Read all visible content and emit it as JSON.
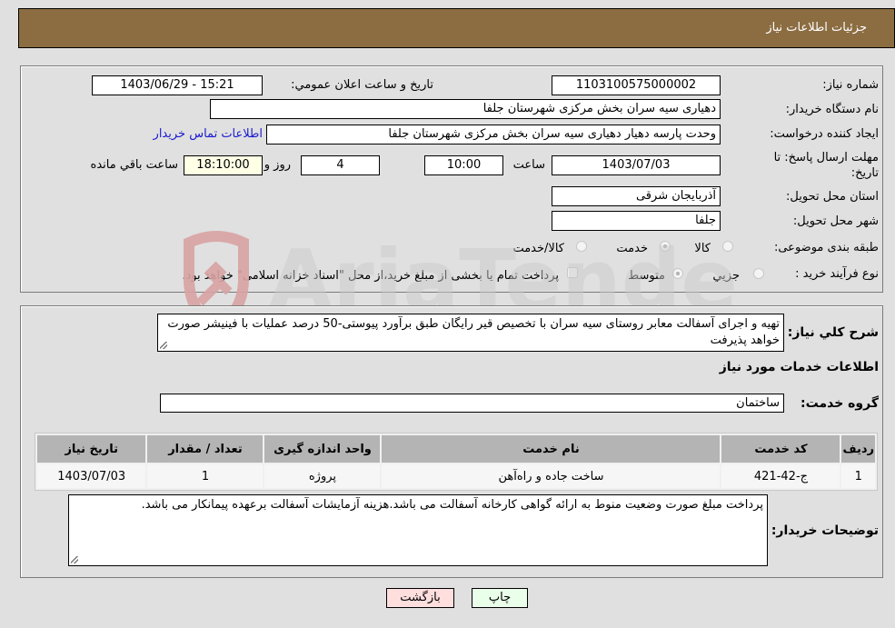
{
  "header": {
    "title": "جزئیات اطلاعات نیاز"
  },
  "form": {
    "need_number": {
      "label": "شماره نیاز:",
      "value": "1103100575000002"
    },
    "announce_datetime": {
      "label": "تاریخ و ساعت اعلان عمومي:",
      "value": "1403/06/29 - 15:21"
    },
    "buyer_org": {
      "label": "نام دستگاه خريدار:",
      "value": "دهیاری سیه سران بخش مرکزی شهرستان جلفا"
    },
    "requester": {
      "label": "ایجاد کننده درخواست:",
      "value": "وحدت پارسه دهیار دهیاری سیه سران بخش مرکزی شهرستان جلفا"
    },
    "buyer_contact_link": "اطلاعات تماس خريدار",
    "deadline": {
      "label": "مهلت ارسال پاسخ: تا تاریخ:",
      "date": "1403/07/03",
      "time_label": "ساعت",
      "time": "10:00",
      "days": "4",
      "days_label": "روز و",
      "remaining": "18:10:00",
      "remaining_label": "ساعت باقي مانده"
    },
    "province": {
      "label": "استان محل تحویل:",
      "value": "آذربایجان شرقی"
    },
    "city": {
      "label": "شهر محل تحویل:",
      "value": "جلفا"
    },
    "category": {
      "label": "طبقه بندی موضوعی:",
      "options": [
        "کالا",
        "خدمت",
        "کالا/خدمت"
      ],
      "selected": "خدمت"
    },
    "purchase_type": {
      "label": "نوع فرآیند خرید :",
      "options": [
        "جزيي",
        "متوسط"
      ],
      "selected": "متوسط",
      "treasury_checkbox_label": "پرداخت تمام یا بخشی از مبلغ خرید،از محل \"اسناد خزانه اسلامی\" خواهد بود.",
      "treasury_checked": false
    }
  },
  "details": {
    "description_label": "شرح كلي نياز:",
    "description": "تهیه و اجرای آسفالت معابر روستای سیه سران با تخصیص قیر رایگان طبق برآورد پیوستی-50 درصد عملیات با فینیشر صورت خواهد پذیرفت",
    "services_heading": "اطلاعات خدمات مورد نياز",
    "service_group_label": "گروه خدمت:",
    "service_group": "ساختمان",
    "table": {
      "headers": [
        "رديف",
        "کد خدمت",
        "نام خدمت",
        "واحد اندازه گیری",
        "تعداد / مقدار",
        "تاریخ نیاز"
      ],
      "rows": [
        [
          "1",
          "ج-42-421",
          "ساخت جاده و راه‌آهن",
          "پروژه",
          "1",
          "1403/07/03"
        ]
      ]
    },
    "buyer_notes_label": "توضیحات خریدار:",
    "buyer_notes": "پرداخت مبلغ صورت وضعیت منوط به ارائه گواهی کارخانه آسفالت می باشد.هزینه آزمایشات آسفالت برعهده پیمانکار می باشد."
  },
  "buttons": {
    "print": "چاپ",
    "back": "بازگشت"
  },
  "watermark": "AriaTender.neT",
  "colors": {
    "header_bg": "#8c6d42",
    "back_btn_bg": "#ffdede",
    "print_btn_bg": "#eaffea",
    "link": "#1a1ad1"
  }
}
